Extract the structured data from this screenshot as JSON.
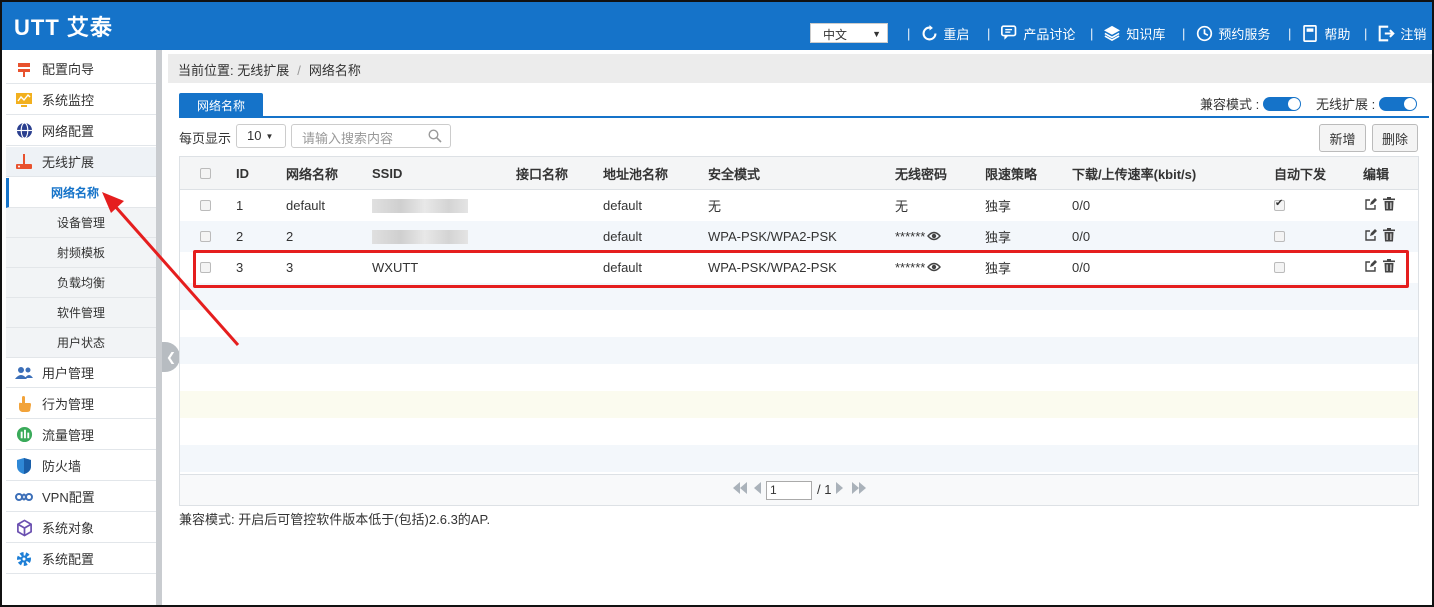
{
  "header": {
    "logo": "UTT 艾泰",
    "language": "中文",
    "nav": [
      {
        "label": "重启",
        "icon": "reboot-icon"
      },
      {
        "label": "产品讨论",
        "icon": "chat-icon"
      },
      {
        "label": "知识库",
        "icon": "layers-icon"
      },
      {
        "label": "预约服务",
        "icon": "appointment-icon"
      },
      {
        "label": "帮助",
        "icon": "book-icon"
      },
      {
        "label": "注销",
        "icon": "logout-icon"
      }
    ],
    "separator": "|"
  },
  "sidebar": {
    "items": [
      {
        "label": "配置向导",
        "icon": "wizard-icon"
      },
      {
        "label": "系统监控",
        "icon": "monitor-icon"
      },
      {
        "label": "网络配置",
        "icon": "globe-icon"
      },
      {
        "label": "无线扩展",
        "icon": "wireless-ap-icon"
      },
      {
        "label": "用户管理",
        "icon": "users-icon"
      },
      {
        "label": "行为管理",
        "icon": "hand-icon"
      },
      {
        "label": "流量管理",
        "icon": "traffic-icon"
      },
      {
        "label": "防火墙",
        "icon": "shield-icon"
      },
      {
        "label": "VPN配置",
        "icon": "vpn-icon"
      },
      {
        "label": "系统对象",
        "icon": "cube-icon"
      },
      {
        "label": "系统配置",
        "icon": "gear-icon"
      }
    ],
    "subitems": [
      "网络名称",
      "设备管理",
      "射频模板",
      "负载均衡",
      "软件管理",
      "用户状态"
    ]
  },
  "breadcrumb": {
    "prefix": "当前位置: 无线扩展",
    "slash": "/",
    "current": "网络名称"
  },
  "tab": {
    "label": "网络名称"
  },
  "toggles": {
    "compat_label": "兼容模式 :",
    "wireless_label": "无线扩展 :"
  },
  "toolbar": {
    "perpage_label": "每页显示",
    "perpage_value": "10",
    "search_placeholder": "请输入搜索内容",
    "add_label": "新增",
    "delete_label": "删除"
  },
  "table": {
    "headers": [
      "ID",
      "网络名称",
      "SSID",
      "接口名称",
      "地址池名称",
      "安全模式",
      "无线密码",
      "限速策略",
      "下载/上传速率(kbit/s)",
      "自动下发",
      "编辑"
    ],
    "rows": [
      {
        "id": "1",
        "name": "default",
        "ssid": "",
        "iface": "",
        "pool": "default",
        "security": "无",
        "password": "无",
        "policy": "独享",
        "rate": "0/0",
        "auto": true
      },
      {
        "id": "2",
        "name": "2",
        "ssid": "",
        "iface": "",
        "pool": "default",
        "security": "WPA-PSK/WPA2-PSK",
        "password": "******",
        "policy": "独享",
        "rate": "0/0",
        "auto": false
      },
      {
        "id": "3",
        "name": "3",
        "ssid": "WXUTT",
        "iface": "",
        "pool": "default",
        "security": "WPA-PSK/WPA2-PSK",
        "password": "******",
        "policy": "独享",
        "rate": "0/0",
        "auto": false
      }
    ]
  },
  "pager": {
    "page": "1",
    "total": "/ 1"
  },
  "footnote": "兼容模式: 开启后可管控软件版本低于(包括)2.6.3的AP.",
  "colors": {
    "brand": "#1573c9",
    "annotation": "#e51e1e"
  }
}
